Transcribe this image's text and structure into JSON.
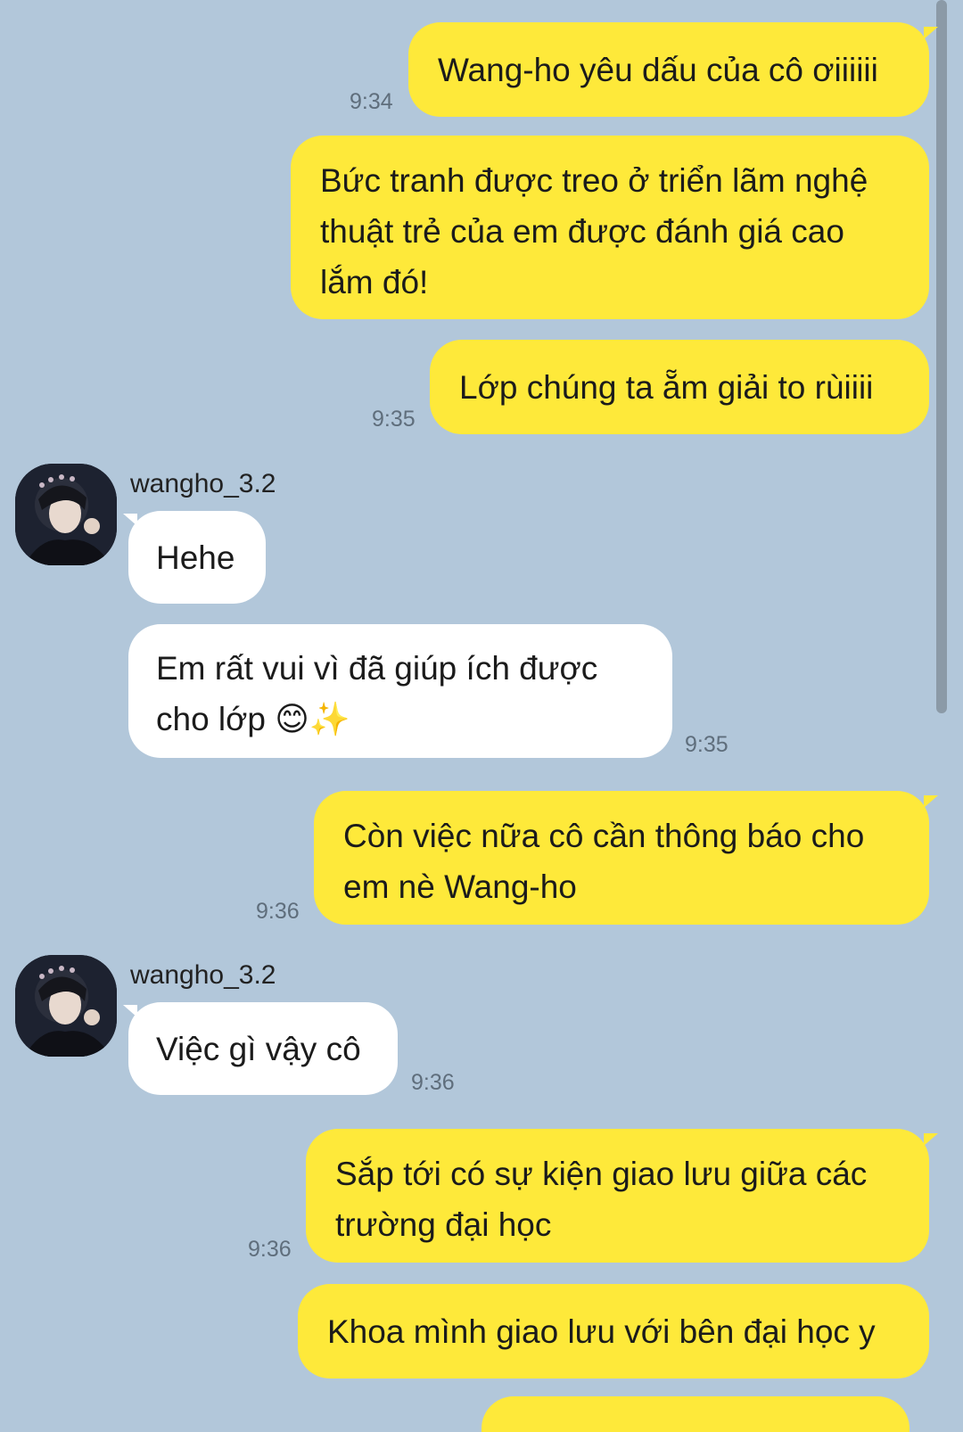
{
  "chat": {
    "contact_name": "wangho_3.2",
    "messages": [
      {
        "text": "Wang-ho yêu dấu của cô ơiiiiii",
        "time": "9:34"
      },
      {
        "text": "Bức tranh được treo ở triển lãm nghệ\nthuật trẻ của em được đánh giá cao\nlắm đó!"
      },
      {
        "text": "Lớp chúng ta ẵm giải to rùiiii",
        "time": "9:35"
      },
      {
        "text": "Hehe"
      },
      {
        "text": "Em rất vui vì đã giúp ích được\ncho lớp 😊✨",
        "time": "9:35"
      },
      {
        "text": "Còn việc nữa cô cần thông báo cho\nem nè Wang-ho",
        "time": "9:36"
      },
      {
        "text": "Việc gì vậy cô",
        "time": "9:36"
      },
      {
        "text": "Sắp tới có sự kiện giao lưu giữa các\ntrường đại học",
        "time": "9:36"
      },
      {
        "text": "Khoa mình giao lưu với bên đại học y"
      }
    ]
  },
  "colors": {
    "background": "#b2c7da",
    "outgoing_bubble": "#fee93a",
    "incoming_bubble": "#ffffff"
  },
  "icons": {
    "avatar": "profile-photo",
    "scrollbar": "scrollbar-thumb"
  }
}
